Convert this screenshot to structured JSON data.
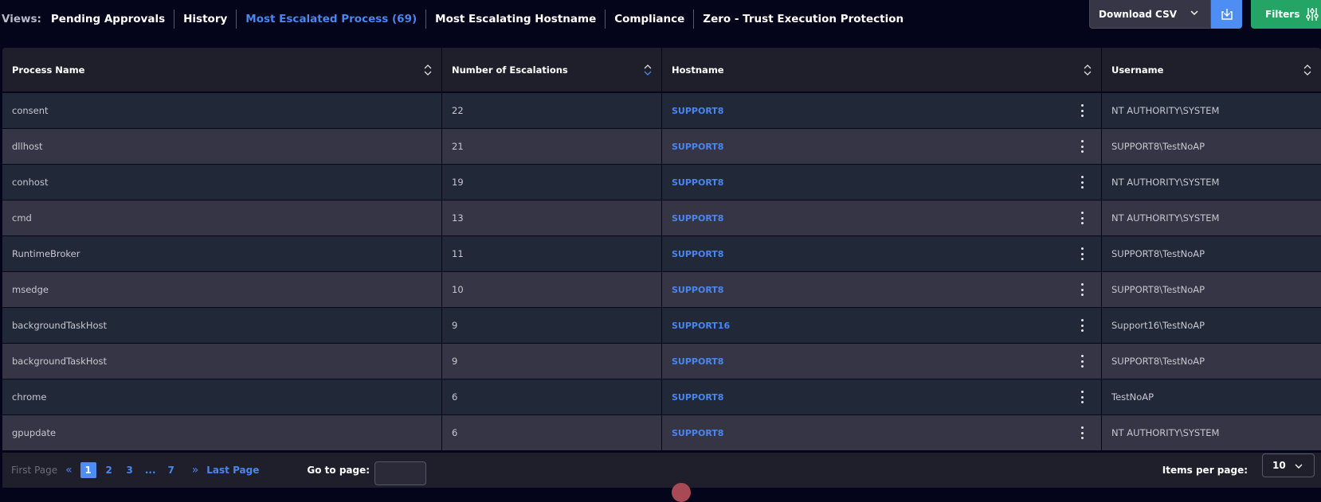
{
  "views": {
    "label": "Views:",
    "tabs": [
      {
        "label": "Pending Approvals",
        "active": false
      },
      {
        "label": "History",
        "active": false
      },
      {
        "label": "Most Escalated Process (69)",
        "active": true
      },
      {
        "label": "Most Escalating Hostname",
        "active": false
      },
      {
        "label": "Compliance",
        "active": false
      },
      {
        "label": "Zero - Trust Execution Protection",
        "active": false
      }
    ]
  },
  "toolbar": {
    "download_label": "Download CSV",
    "download_icon": "download-icon",
    "filters_label": "Filters",
    "filters_icon": "sliders-icon"
  },
  "table": {
    "columns": [
      "Process Name",
      "Number of Escalations",
      "Hostname",
      "Username"
    ],
    "sorted_column": "Number of Escalations",
    "sort_direction": "descending",
    "rows": [
      {
        "process": "consent",
        "count": "22",
        "host": "SUPPORT8",
        "user": "NT AUTHORITY\\SYSTEM"
      },
      {
        "process": "dllhost",
        "count": "21",
        "host": "SUPPORT8",
        "user": "SUPPORT8\\TestNoAP"
      },
      {
        "process": "conhost",
        "count": "19",
        "host": "SUPPORT8",
        "user": "NT AUTHORITY\\SYSTEM"
      },
      {
        "process": "cmd",
        "count": "13",
        "host": "SUPPORT8",
        "user": "NT AUTHORITY\\SYSTEM"
      },
      {
        "process": "RuntimeBroker",
        "count": "11",
        "host": "SUPPORT8",
        "user": "SUPPORT8\\TestNoAP"
      },
      {
        "process": "msedge",
        "count": "10",
        "host": "SUPPORT8",
        "user": "SUPPORT8\\TestNoAP"
      },
      {
        "process": "backgroundTaskHost",
        "count": "9",
        "host": "SUPPORT16",
        "user": "Support16\\TestNoAP"
      },
      {
        "process": "backgroundTaskHost",
        "count": "9",
        "host": "SUPPORT8",
        "user": "SUPPORT8\\TestNoAP"
      },
      {
        "process": "chrome",
        "count": "6",
        "host": "SUPPORT8",
        "user": "TestNoAP"
      },
      {
        "process": "gpupdate",
        "count": "6",
        "host": "SUPPORT8",
        "user": "NT AUTHORITY\\SYSTEM"
      }
    ]
  },
  "pagination": {
    "first_label": "First Page",
    "last_label": "Last Page",
    "pages": [
      "1",
      "2",
      "3",
      "...",
      "7"
    ],
    "current": "1",
    "goto_label": "Go to page:",
    "goto_value": "",
    "items_per_page_label": "Items per page:",
    "items_per_page": "10"
  },
  "colors": {
    "accent": "#4a86f0",
    "filters": "#24a566",
    "background": "#04041a"
  }
}
